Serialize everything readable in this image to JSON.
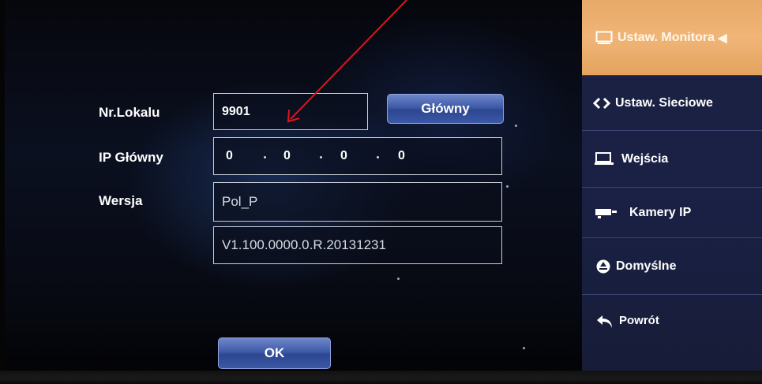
{
  "form": {
    "nr_lokalu_label": "Nr.Lokalu",
    "nr_lokalu_value": "9901",
    "glowny_button_label": "Główny",
    "ip_glowny_label": "IP Główny",
    "ip_segments": [
      "0",
      "0",
      "0",
      "0"
    ],
    "wersja_label": "Wersja",
    "wersja_value": "Pol_P",
    "version_string": "V1.100.0000.0.R.20131231",
    "ok_label": "OK"
  },
  "sidebar": {
    "items": [
      {
        "label": "Ustaw. Monitora",
        "icon": "monitor-icon",
        "active": true
      },
      {
        "label": "Ustaw. Sieciowe",
        "icon": "network-arrows-icon",
        "active": false
      },
      {
        "label": "Wejścia",
        "icon": "input-icon",
        "active": false
      },
      {
        "label": "Kamery IP",
        "icon": "ip-camera-icon",
        "active": false
      },
      {
        "label": "Domyślne",
        "icon": "recycle-icon",
        "active": false
      },
      {
        "label": "Powrót",
        "icon": "back-arrow-icon",
        "active": false
      }
    ]
  },
  "colors": {
    "active_tab": "#f0b577",
    "sidebar_bg": "#1a2145",
    "button_blue": "#3e5aa8",
    "annotation_arrow": "#e0141b"
  }
}
